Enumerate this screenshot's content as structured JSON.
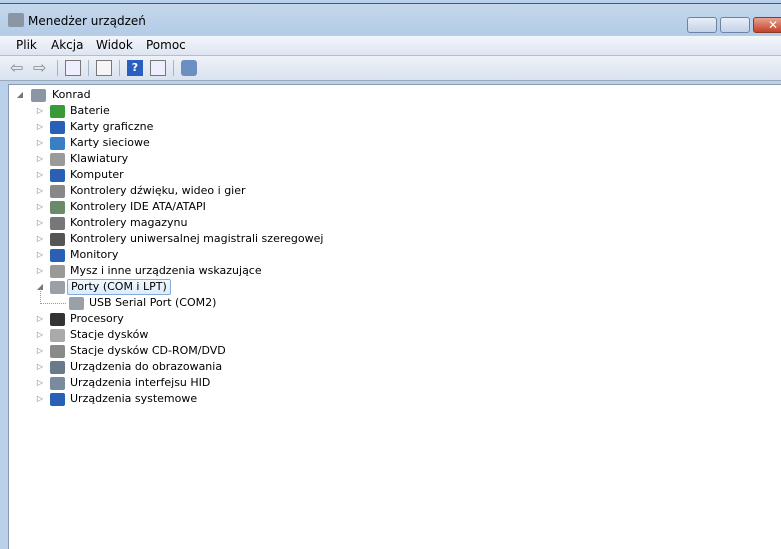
{
  "window": {
    "title": "Menedżer urządzeń",
    "close_glyph": "✕"
  },
  "menu": [
    "Plik",
    "Akcja",
    "Widok",
    "Pomoc"
  ],
  "toolbar": [
    "back-icon",
    "forward-icon",
    "show-hide-console-tree-icon",
    "properties-icon",
    "help-icon",
    "action-pane-icon",
    "scan-hardware-icon"
  ],
  "tree": {
    "root": "Konrad",
    "categories": [
      {
        "label": "Baterie",
        "color": "#3a9a3a"
      },
      {
        "label": "Karty graficzne",
        "color": "#2a5fb8"
      },
      {
        "label": "Karty sieciowe",
        "color": "#3a7fc4"
      },
      {
        "label": "Klawiatury",
        "color": "#9a9a9a"
      },
      {
        "label": "Komputer",
        "color": "#2a5fb8"
      },
      {
        "label": "Kontrolery dźwięku, wideo i gier",
        "color": "#888888"
      },
      {
        "label": "Kontrolery IDE ATA/ATAPI",
        "color": "#6a8a6a"
      },
      {
        "label": "Kontrolery magazynu",
        "color": "#777777"
      },
      {
        "label": "Kontrolery uniwersalnej magistrali szeregowej",
        "color": "#555555"
      },
      {
        "label": "Monitory",
        "color": "#2a5fb8"
      },
      {
        "label": "Mysz i inne urządzenia wskazujące",
        "color": "#999999"
      },
      {
        "label": "Porty (COM i LPT)",
        "color": "#9aa0a8",
        "expanded": true,
        "selected": true,
        "children": [
          "USB Serial Port (COM2)"
        ]
      },
      {
        "label": "Procesory",
        "color": "#333333"
      },
      {
        "label": "Stacje dysków",
        "color": "#aaaaaa"
      },
      {
        "label": "Stacje dysków CD-ROM/DVD",
        "color": "#8a8a8a"
      },
      {
        "label": "Urządzenia do obrazowania",
        "color": "#6a7a8a"
      },
      {
        "label": "Urządzenia interfejsu HID",
        "color": "#7a8aa0"
      },
      {
        "label": "Urządzenia systemowe",
        "color": "#2a5fb8"
      }
    ]
  }
}
